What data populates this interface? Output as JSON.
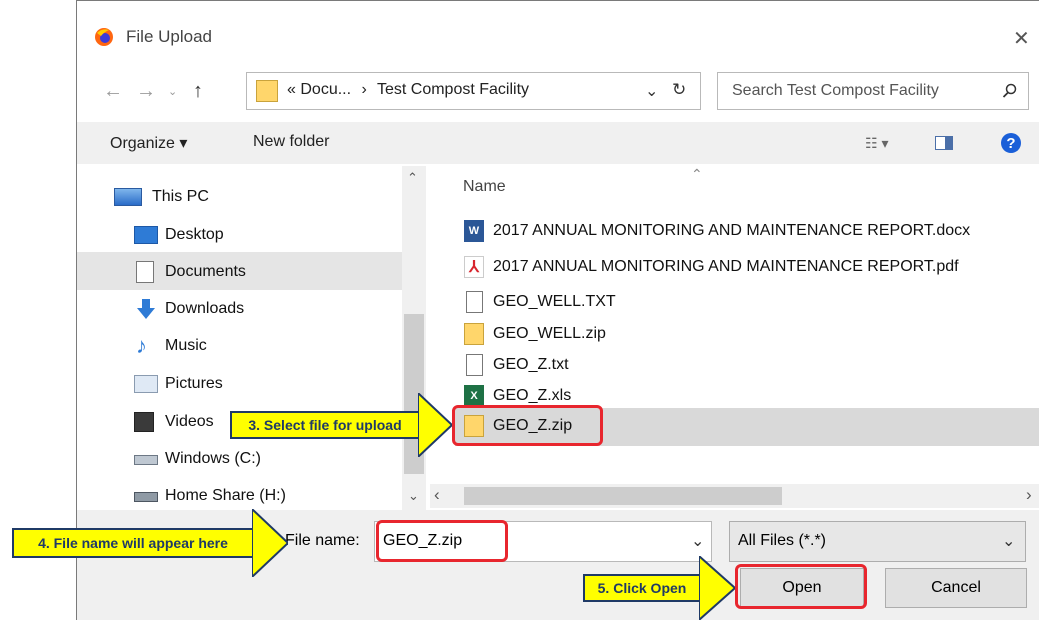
{
  "window": {
    "title": "File Upload",
    "close_glyph": "✕"
  },
  "address": {
    "path_parts": [
      "«",
      "Docu...",
      "›",
      "Test Compost Facility"
    ],
    "search_placeholder": "Search Test Compost Facility"
  },
  "toolbar": {
    "organize_label": "Organize ▾",
    "new_folder_label": "New folder"
  },
  "sidebar": {
    "items": [
      {
        "label": "This PC",
        "icon": "monitor-icon"
      },
      {
        "label": "Desktop",
        "icon": "desktop-folder-icon"
      },
      {
        "label": "Documents",
        "icon": "documents-icon",
        "selected": true
      },
      {
        "label": "Downloads",
        "icon": "download-arrow-icon"
      },
      {
        "label": "Music",
        "icon": "music-note-icon"
      },
      {
        "label": "Pictures",
        "icon": "pictures-icon"
      },
      {
        "label": "Videos",
        "icon": "videos-icon"
      },
      {
        "label": "Windows (C:)",
        "icon": "drive-icon"
      },
      {
        "label": "Home Share (H:)",
        "icon": "network-drive-icon"
      }
    ]
  },
  "file_list": {
    "column_name": "Name",
    "files": [
      {
        "name": "2017 ANNUAL MONITORING AND MAINTENANCE REPORT.docx",
        "icon": "word-doc-icon"
      },
      {
        "name": "2017 ANNUAL MONITORING AND MAINTENANCE REPORT.pdf",
        "icon": "pdf-icon"
      },
      {
        "name": "GEO_WELL.TXT",
        "icon": "text-file-icon"
      },
      {
        "name": "GEO_WELL.zip",
        "icon": "zip-folder-icon"
      },
      {
        "name": "GEO_Z.txt",
        "icon": "text-file-icon"
      },
      {
        "name": "GEO_Z.xls",
        "icon": "excel-icon"
      },
      {
        "name": "GEO_Z.zip",
        "icon": "zip-folder-icon",
        "selected": true
      }
    ]
  },
  "filename": {
    "label": "File name:",
    "value": "GEO_Z.zip"
  },
  "filetype": {
    "value": "All Files (*.*)"
  },
  "buttons": {
    "open": "Open",
    "cancel": "Cancel"
  },
  "callouts": {
    "select": "3. Select file for upload",
    "filename": "4. File name will appear here",
    "open": "5. Click Open"
  },
  "colors": {
    "callout_fill": "#ffff00",
    "callout_border": "#1f3a66",
    "highlight_red": "#e8262e",
    "selection": "#cce8ff"
  }
}
